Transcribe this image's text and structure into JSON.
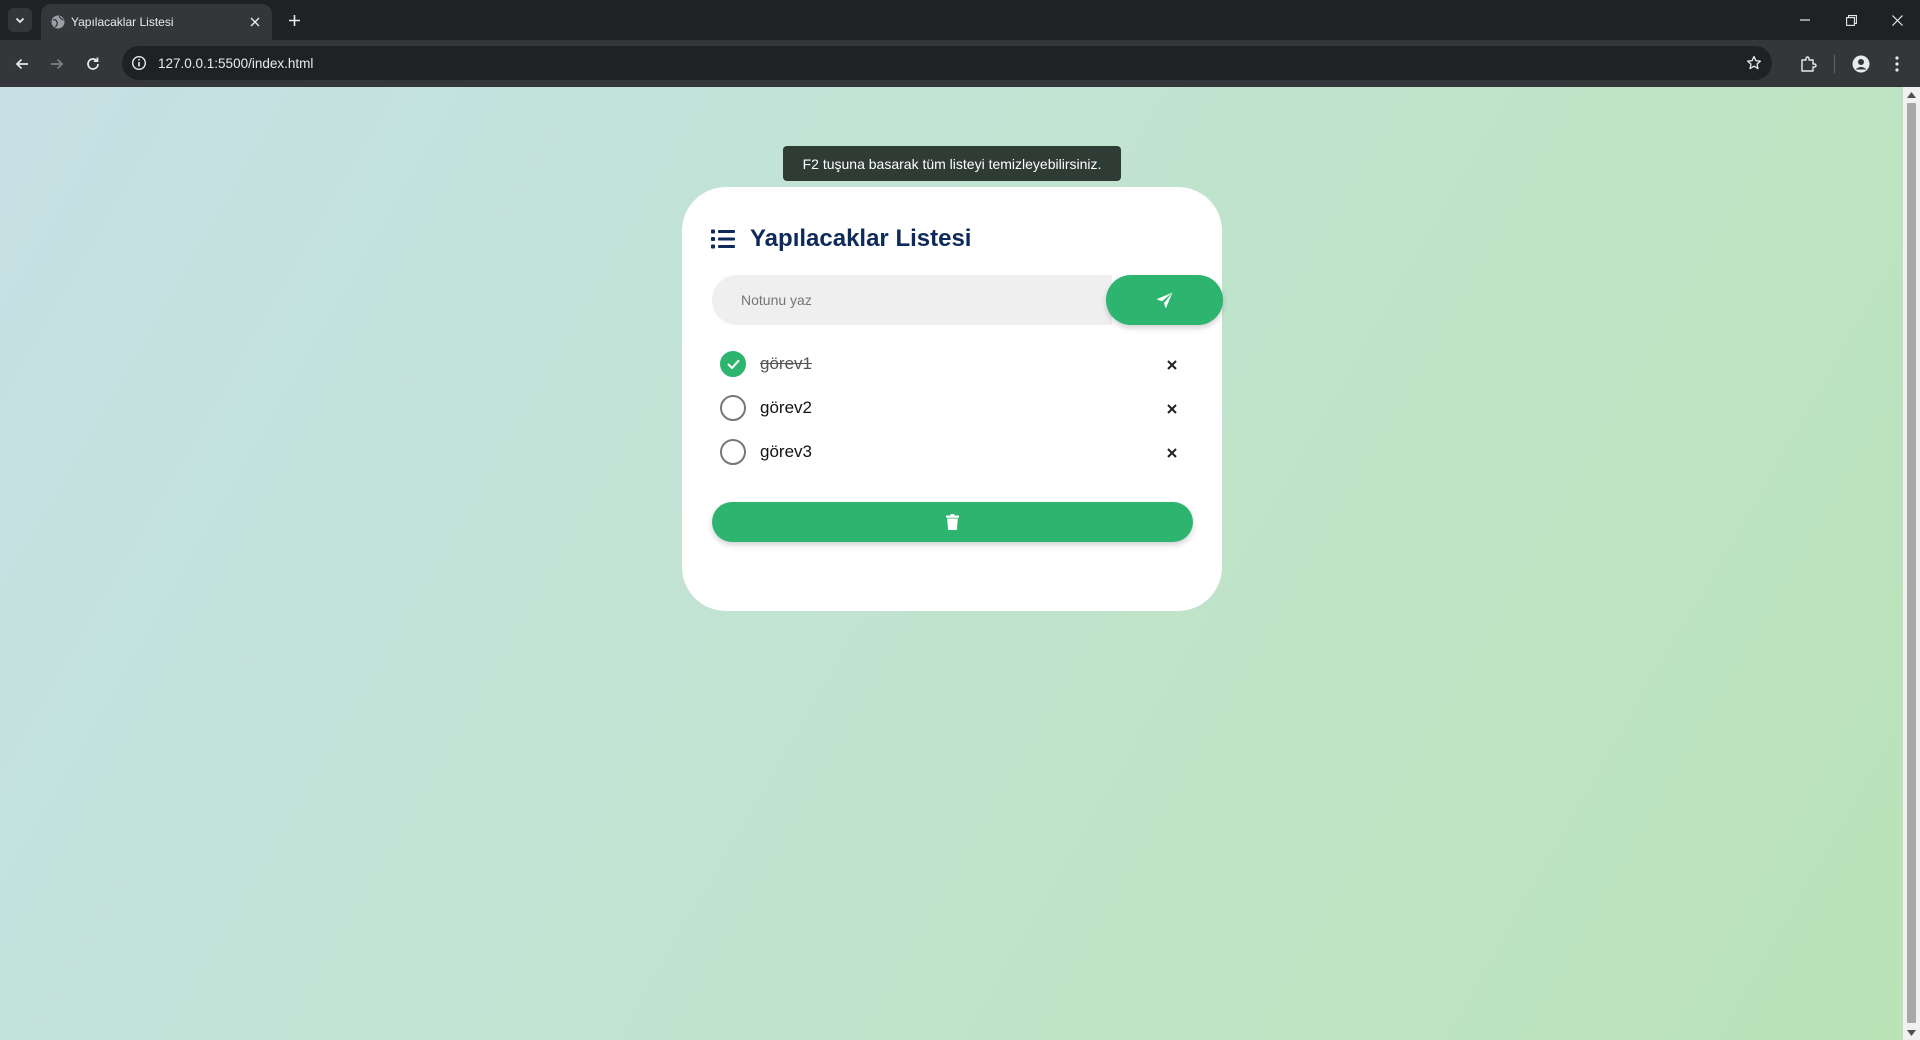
{
  "browser": {
    "tab_title": "Yapılacaklar Listesi",
    "url": "127.0.0.1:5500/index.html"
  },
  "page": {
    "tooltip": "F2 tuşuna basarak tüm listeyi temizleyebilirsiniz.",
    "title": "Yapılacaklar Listesi",
    "input_placeholder": "Notunu yaz",
    "input_value": "",
    "tasks": [
      {
        "label": "görev1",
        "done": true
      },
      {
        "label": "görev2",
        "done": false
      },
      {
        "label": "görev3",
        "done": false
      }
    ]
  },
  "colors": {
    "accent": "#2db46e",
    "title": "#0d2a5a"
  },
  "icons": {
    "header": "list-icon",
    "send": "paper-plane-icon",
    "clear": "trash-icon",
    "delete": "close-icon",
    "done": "check-icon"
  }
}
